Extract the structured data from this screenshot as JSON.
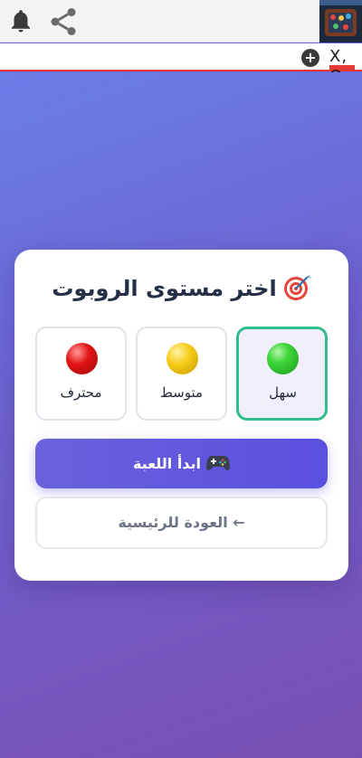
{
  "topbar": {
    "icons": [
      "bell-icon",
      "share-icon",
      "game-thumbnail"
    ]
  },
  "subbar": {
    "add_icon": "plus-circle-icon",
    "tab_label": "X, O"
  },
  "dialog": {
    "title_icon": "target-icon",
    "title": "اختر مستوى الروبوت",
    "levels": [
      {
        "label": "سهل",
        "color": "#3dd63a",
        "selected": true
      },
      {
        "label": "متوسط",
        "color": "#f5cc18",
        "selected": false
      },
      {
        "label": "محترف",
        "color": "#e21414",
        "selected": false
      }
    ],
    "start_icon": "gamepad-icon",
    "start_label": "ابدأ اللعبة",
    "back_label": "← العودة للرئيسية"
  },
  "colors": {
    "accent": "#5a50df",
    "selected_border": "#2ebd8c",
    "background_gradient": [
      "#6a7ee8",
      "#7a4fb2"
    ]
  }
}
